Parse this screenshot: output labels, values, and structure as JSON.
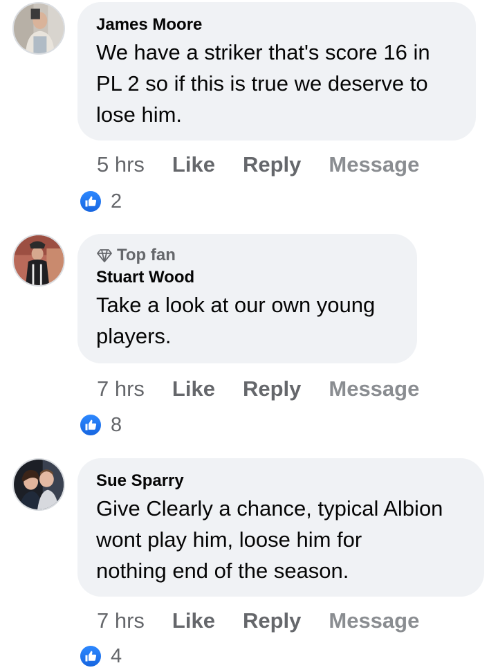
{
  "comments": [
    {
      "author": "James Moore",
      "badge": "",
      "text": "We have a striker that's score 16 in\nPL 2 so if this is true we deserve to\nlose him.",
      "time": "5 hrs",
      "like_label": "Like",
      "reply_label": "Reply",
      "message_label": "Message",
      "reaction_icon": "like-thumb-icon",
      "reaction_count": "2"
    },
    {
      "author": "Stuart Wood",
      "badge": "Top fan",
      "text": "Take a look at our own young\nplayers.",
      "time": "7 hrs",
      "like_label": "Like",
      "reply_label": "Reply",
      "message_label": "Message",
      "reaction_icon": "like-thumb-icon",
      "reaction_count": "8"
    },
    {
      "author": "Sue Sparry",
      "badge": "",
      "text": "Give Clearly a chance, typical Albion\nwont play him, loose him for\nnothing end of the season.",
      "time": "7 hrs",
      "like_label": "Like",
      "reply_label": "Reply",
      "message_label": "Message",
      "reaction_icon": "like-thumb-icon",
      "reaction_count": "4"
    }
  ],
  "colors": {
    "bubble": "#f0f2f5",
    "secondary_text": "#65676b",
    "like_blue": "#1877f2"
  }
}
